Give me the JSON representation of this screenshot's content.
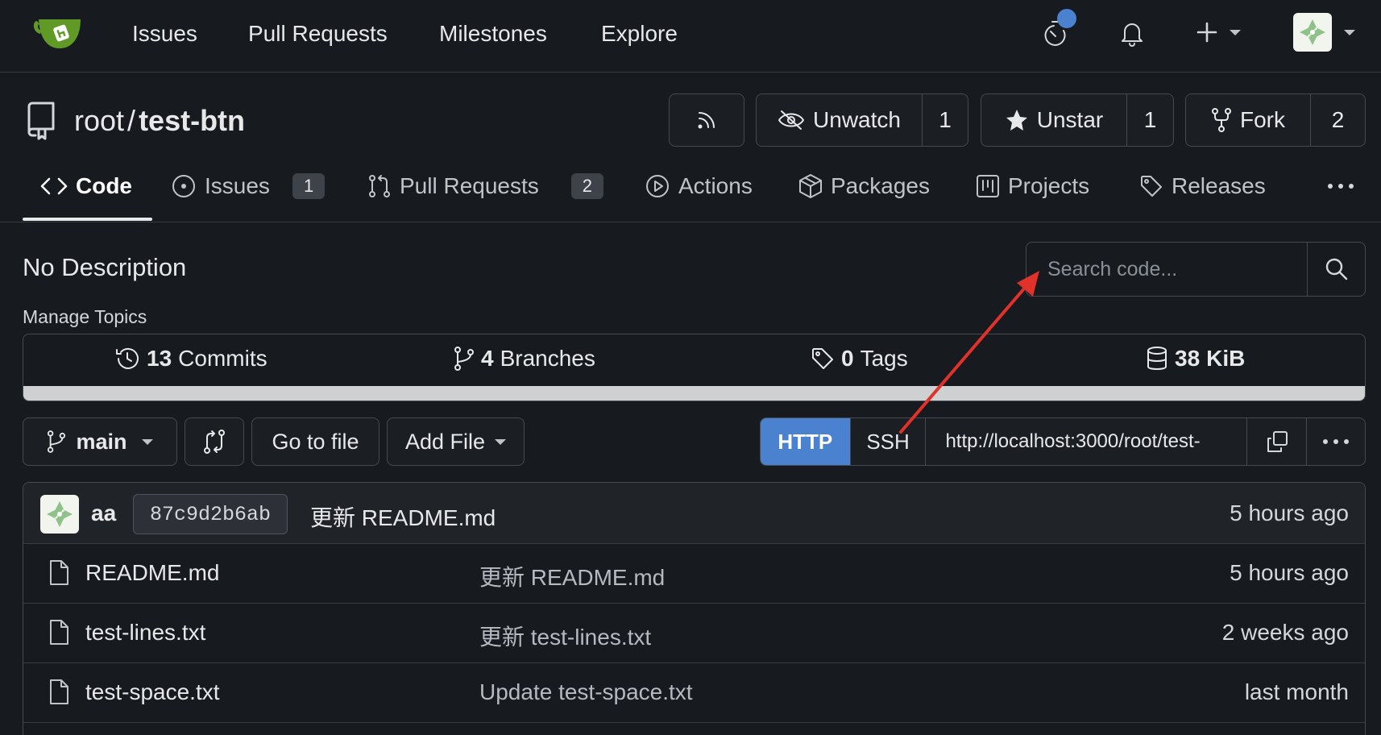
{
  "nav": {
    "links": [
      "Issues",
      "Pull Requests",
      "Milestones",
      "Explore"
    ],
    "icons": [
      "stopwatch-icon",
      "bell-icon",
      "plus-icon",
      "avatar"
    ]
  },
  "repo": {
    "owner": "root",
    "separator": "/",
    "name": "test-btn",
    "unwatch_label": "Unwatch",
    "watch_count": "1",
    "unstar_label": "Unstar",
    "star_count": "1",
    "fork_label": "Fork",
    "fork_count": "2"
  },
  "tabs": {
    "code": "Code",
    "issues": "Issues",
    "issues_count": "1",
    "pulls": "Pull Requests",
    "pulls_count": "2",
    "actions": "Actions",
    "packages": "Packages",
    "projects": "Projects",
    "releases": "Releases"
  },
  "description": "No Description",
  "manage_topics": "Manage Topics",
  "search": {
    "placeholder": "Search code..."
  },
  "stats": {
    "commits_num": "13",
    "commits_label": "Commits",
    "branches_num": "4",
    "branches_label": "Branches",
    "tags_num": "0",
    "tags_label": "Tags",
    "size_num": "38",
    "size_label": "KiB"
  },
  "branch_bar": {
    "branch": "main",
    "go_to_file": "Go to file",
    "add_file": "Add File",
    "http": "HTTP",
    "ssh": "SSH",
    "clone_url": "http://localhost:3000/root/test-"
  },
  "latest_commit": {
    "author": "aa",
    "sha": "87c9d2b6ab",
    "message": "更新 README.md",
    "time": "5 hours ago"
  },
  "files": [
    {
      "name": "README.md",
      "message": "更新 README.md",
      "time": "5 hours ago"
    },
    {
      "name": "test-lines.txt",
      "message": "更新 test-lines.txt",
      "time": "2 weeks ago"
    },
    {
      "name": "test-space.txt",
      "message": "Update test-space.txt",
      "time": "last month"
    }
  ],
  "colors": {
    "background": "#171a1f",
    "accent": "#4a82cf",
    "annotation_arrow": "#e0312a",
    "logo_green": "#609926"
  }
}
